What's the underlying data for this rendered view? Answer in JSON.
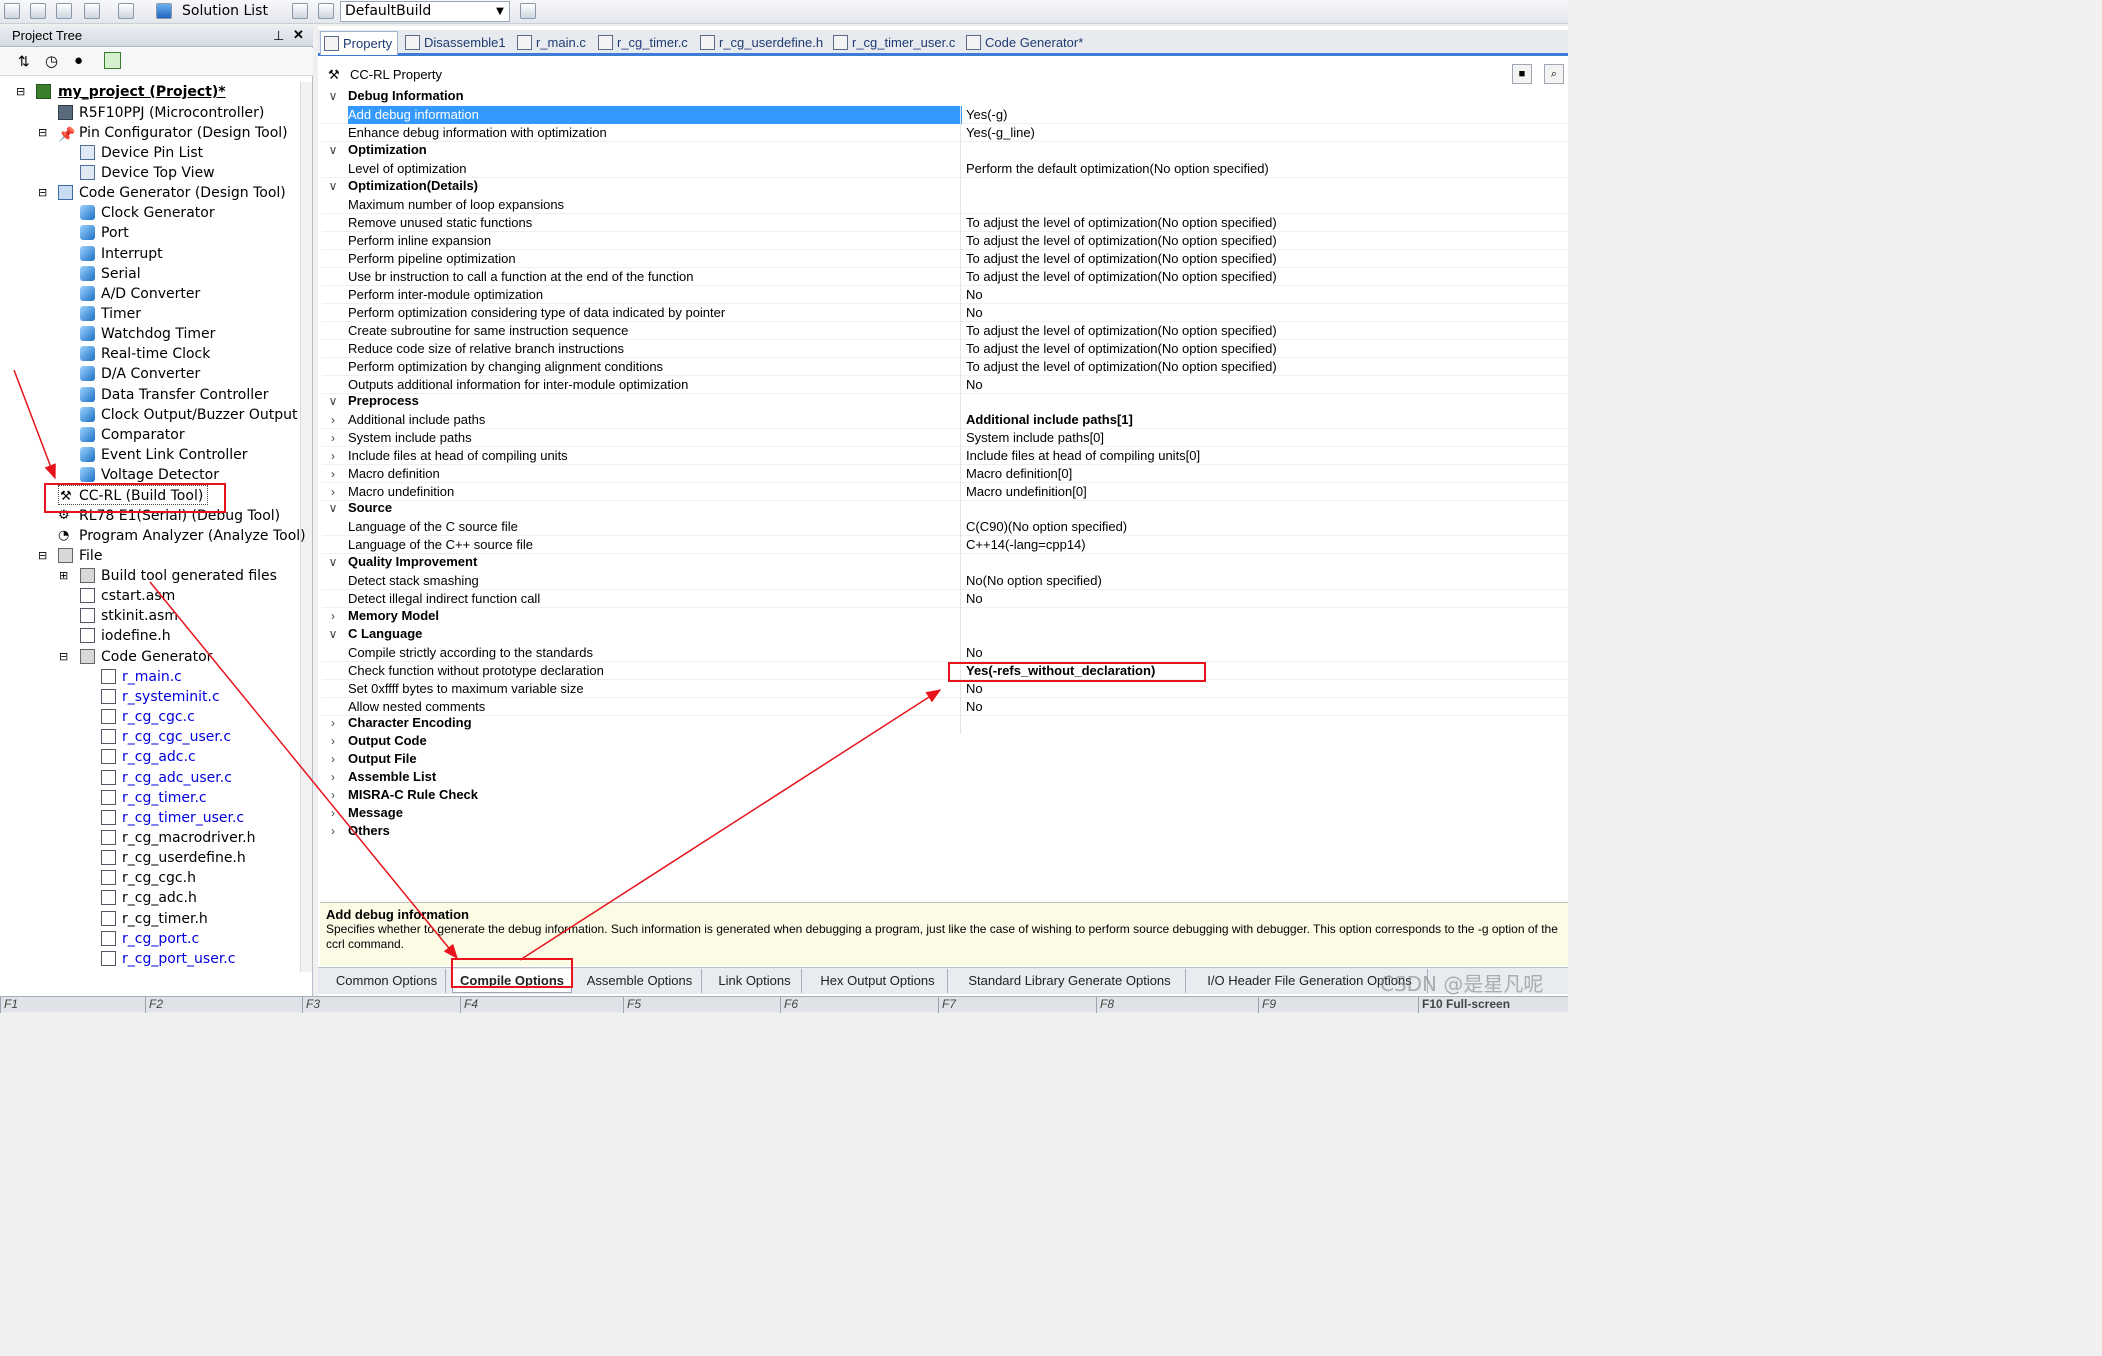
{
  "toolbar": {
    "solution_list_label": "Solution List",
    "build_config": "DefaultBuild"
  },
  "project_tree": {
    "title": "Project Tree",
    "items": [
      {
        "label": "my_project (Project)*"
      },
      {
        "label": "R5F10PPJ (Microcontroller)"
      },
      {
        "label": "Pin Configurator (Design Tool)"
      },
      {
        "label": "Device Pin List"
      },
      {
        "label": "Device Top View"
      },
      {
        "label": "Code Generator (Design Tool)"
      },
      {
        "label": "Clock Generator"
      },
      {
        "label": "Port"
      },
      {
        "label": "Interrupt"
      },
      {
        "label": "Serial"
      },
      {
        "label": "A/D Converter"
      },
      {
        "label": "Timer"
      },
      {
        "label": "Watchdog Timer"
      },
      {
        "label": "Real-time Clock"
      },
      {
        "label": "D/A Converter"
      },
      {
        "label": "Data Transfer Controller"
      },
      {
        "label": "Clock Output/Buzzer Output"
      },
      {
        "label": "Comparator"
      },
      {
        "label": "Event Link Controller"
      },
      {
        "label": "Voltage Detector"
      },
      {
        "label": "CC-RL (Build Tool)"
      },
      {
        "label": "RL78 E1(Serial) (Debug Tool)"
      },
      {
        "label": "Program Analyzer (Analyze Tool)"
      },
      {
        "label": "File"
      },
      {
        "label": "Build tool generated files"
      },
      {
        "label": "cstart.asm"
      },
      {
        "label": "stkinit.asm"
      },
      {
        "label": "iodefine.h"
      },
      {
        "label": "Code Generator"
      },
      {
        "label": "r_main.c"
      },
      {
        "label": "r_systeminit.c"
      },
      {
        "label": "r_cg_cgc.c"
      },
      {
        "label": "r_cg_cgc_user.c"
      },
      {
        "label": "r_cg_adc.c"
      },
      {
        "label": "r_cg_adc_user.c"
      },
      {
        "label": "r_cg_timer.c"
      },
      {
        "label": "r_cg_timer_user.c"
      },
      {
        "label": "r_cg_macrodriver.h"
      },
      {
        "label": "r_cg_userdefine.h"
      },
      {
        "label": "r_cg_cgc.h"
      },
      {
        "label": "r_cg_adc.h"
      },
      {
        "label": "r_cg_timer.h"
      },
      {
        "label": "r_cg_port.c"
      },
      {
        "label": "r_cg_port_user.c"
      }
    ]
  },
  "doc_tabs": [
    "Property",
    "Disassemble1",
    "r_main.c",
    "r_cg_timer.c",
    "r_cg_userdefine.h",
    "r_cg_timer_user.c",
    "Code Generator*"
  ],
  "property": {
    "title": "CC-RL Property",
    "rows": [
      {
        "name": "Debug Information",
        "value": ""
      },
      {
        "name": "Add debug information",
        "value": "Yes(-g)"
      },
      {
        "name": "Enhance debug information with optimization",
        "value": "Yes(-g_line)"
      },
      {
        "name": "Optimization",
        "value": ""
      },
      {
        "name": "Level of optimization",
        "value": "Perform the default optimization(No option specified)"
      },
      {
        "name": "Optimization(Details)",
        "value": ""
      },
      {
        "name": "Maximum number of loop expansions",
        "value": ""
      },
      {
        "name": "Remove unused static functions",
        "value": "To adjust the level of optimization(No option specified)"
      },
      {
        "name": "Perform inline expansion",
        "value": "To adjust the level of optimization(No option specified)"
      },
      {
        "name": "Perform pipeline optimization",
        "value": "To adjust the level of optimization(No option specified)"
      },
      {
        "name": "Use br instruction to call a function at the end of the function",
        "value": "To adjust the level of optimization(No option specified)"
      },
      {
        "name": "Perform inter-module optimization",
        "value": "No"
      },
      {
        "name": "Perform optimization considering type of data indicated by pointer",
        "value": "No"
      },
      {
        "name": "Create subroutine for same instruction sequence",
        "value": "To adjust the level of optimization(No option specified)"
      },
      {
        "name": "Reduce code size of relative branch instructions",
        "value": "To adjust the level of optimization(No option specified)"
      },
      {
        "name": "Perform optimization by changing alignment conditions",
        "value": "To adjust the level of optimization(No option specified)"
      },
      {
        "name": "Outputs additional information for inter-module optimization",
        "value": "No"
      },
      {
        "name": "Preprocess",
        "value": ""
      },
      {
        "name": "Additional include paths",
        "value": "Additional include paths[1]"
      },
      {
        "name": "System include paths",
        "value": "System include paths[0]"
      },
      {
        "name": "Include files at head of compiling units",
        "value": "Include files at head of compiling units[0]"
      },
      {
        "name": "Macro definition",
        "value": "Macro definition[0]"
      },
      {
        "name": "Macro undefinition",
        "value": "Macro undefinition[0]"
      },
      {
        "name": "Source",
        "value": ""
      },
      {
        "name": "Language of the C source file",
        "value": "C(C90)(No option specified)"
      },
      {
        "name": "Language of the C++ source file",
        "value": "C++14(-lang=cpp14)"
      },
      {
        "name": "Quality Improvement",
        "value": ""
      },
      {
        "name": "Detect stack smashing",
        "value": "No(No option specified)"
      },
      {
        "name": "Detect illegal indirect function call",
        "value": "No"
      },
      {
        "name": "Memory Model",
        "value": ""
      },
      {
        "name": "C Language",
        "value": ""
      },
      {
        "name": "Compile strictly according to the standards",
        "value": "No"
      },
      {
        "name": "Check function without prototype declaration",
        "value": "Yes(-refs_without_declaration)"
      },
      {
        "name": "Set 0xffff bytes to maximum variable size",
        "value": "No"
      },
      {
        "name": "Allow nested comments",
        "value": "No"
      },
      {
        "name": "Character Encoding",
        "value": ""
      },
      {
        "name": "Output Code",
        "value": ""
      },
      {
        "name": "Output File",
        "value": ""
      },
      {
        "name": "Assemble List",
        "value": ""
      },
      {
        "name": "MISRA-C Rule Check",
        "value": ""
      },
      {
        "name": "Message",
        "value": ""
      },
      {
        "name": "Others",
        "value": ""
      }
    ]
  },
  "description": {
    "title": "Add debug information",
    "text": "Specifies whether to generate the debug information. Such information is generated when debugging a program, just like the case of wishing to perform source debugging with debugger. This option corresponds to the -g option of the ccrl command."
  },
  "bottom_tabs": [
    "Common Options",
    "Compile Options",
    "Assemble Options",
    "Link Options",
    "Hex Output Options",
    "Standard Library Generate Options",
    "I/O Header File Generation Options"
  ],
  "status_bar": {
    "fkeys": [
      "F1",
      "F2",
      "F3",
      "F4",
      "F5",
      "F6",
      "F7",
      "F8",
      "F9"
    ],
    "fullscreen": "F10 Full-screen"
  },
  "watermark": "CSDN @是星凡呢",
  "colors": {
    "accent": "#3d7bd6",
    "selection": "#3399ff",
    "annotation": "#e8141c"
  }
}
